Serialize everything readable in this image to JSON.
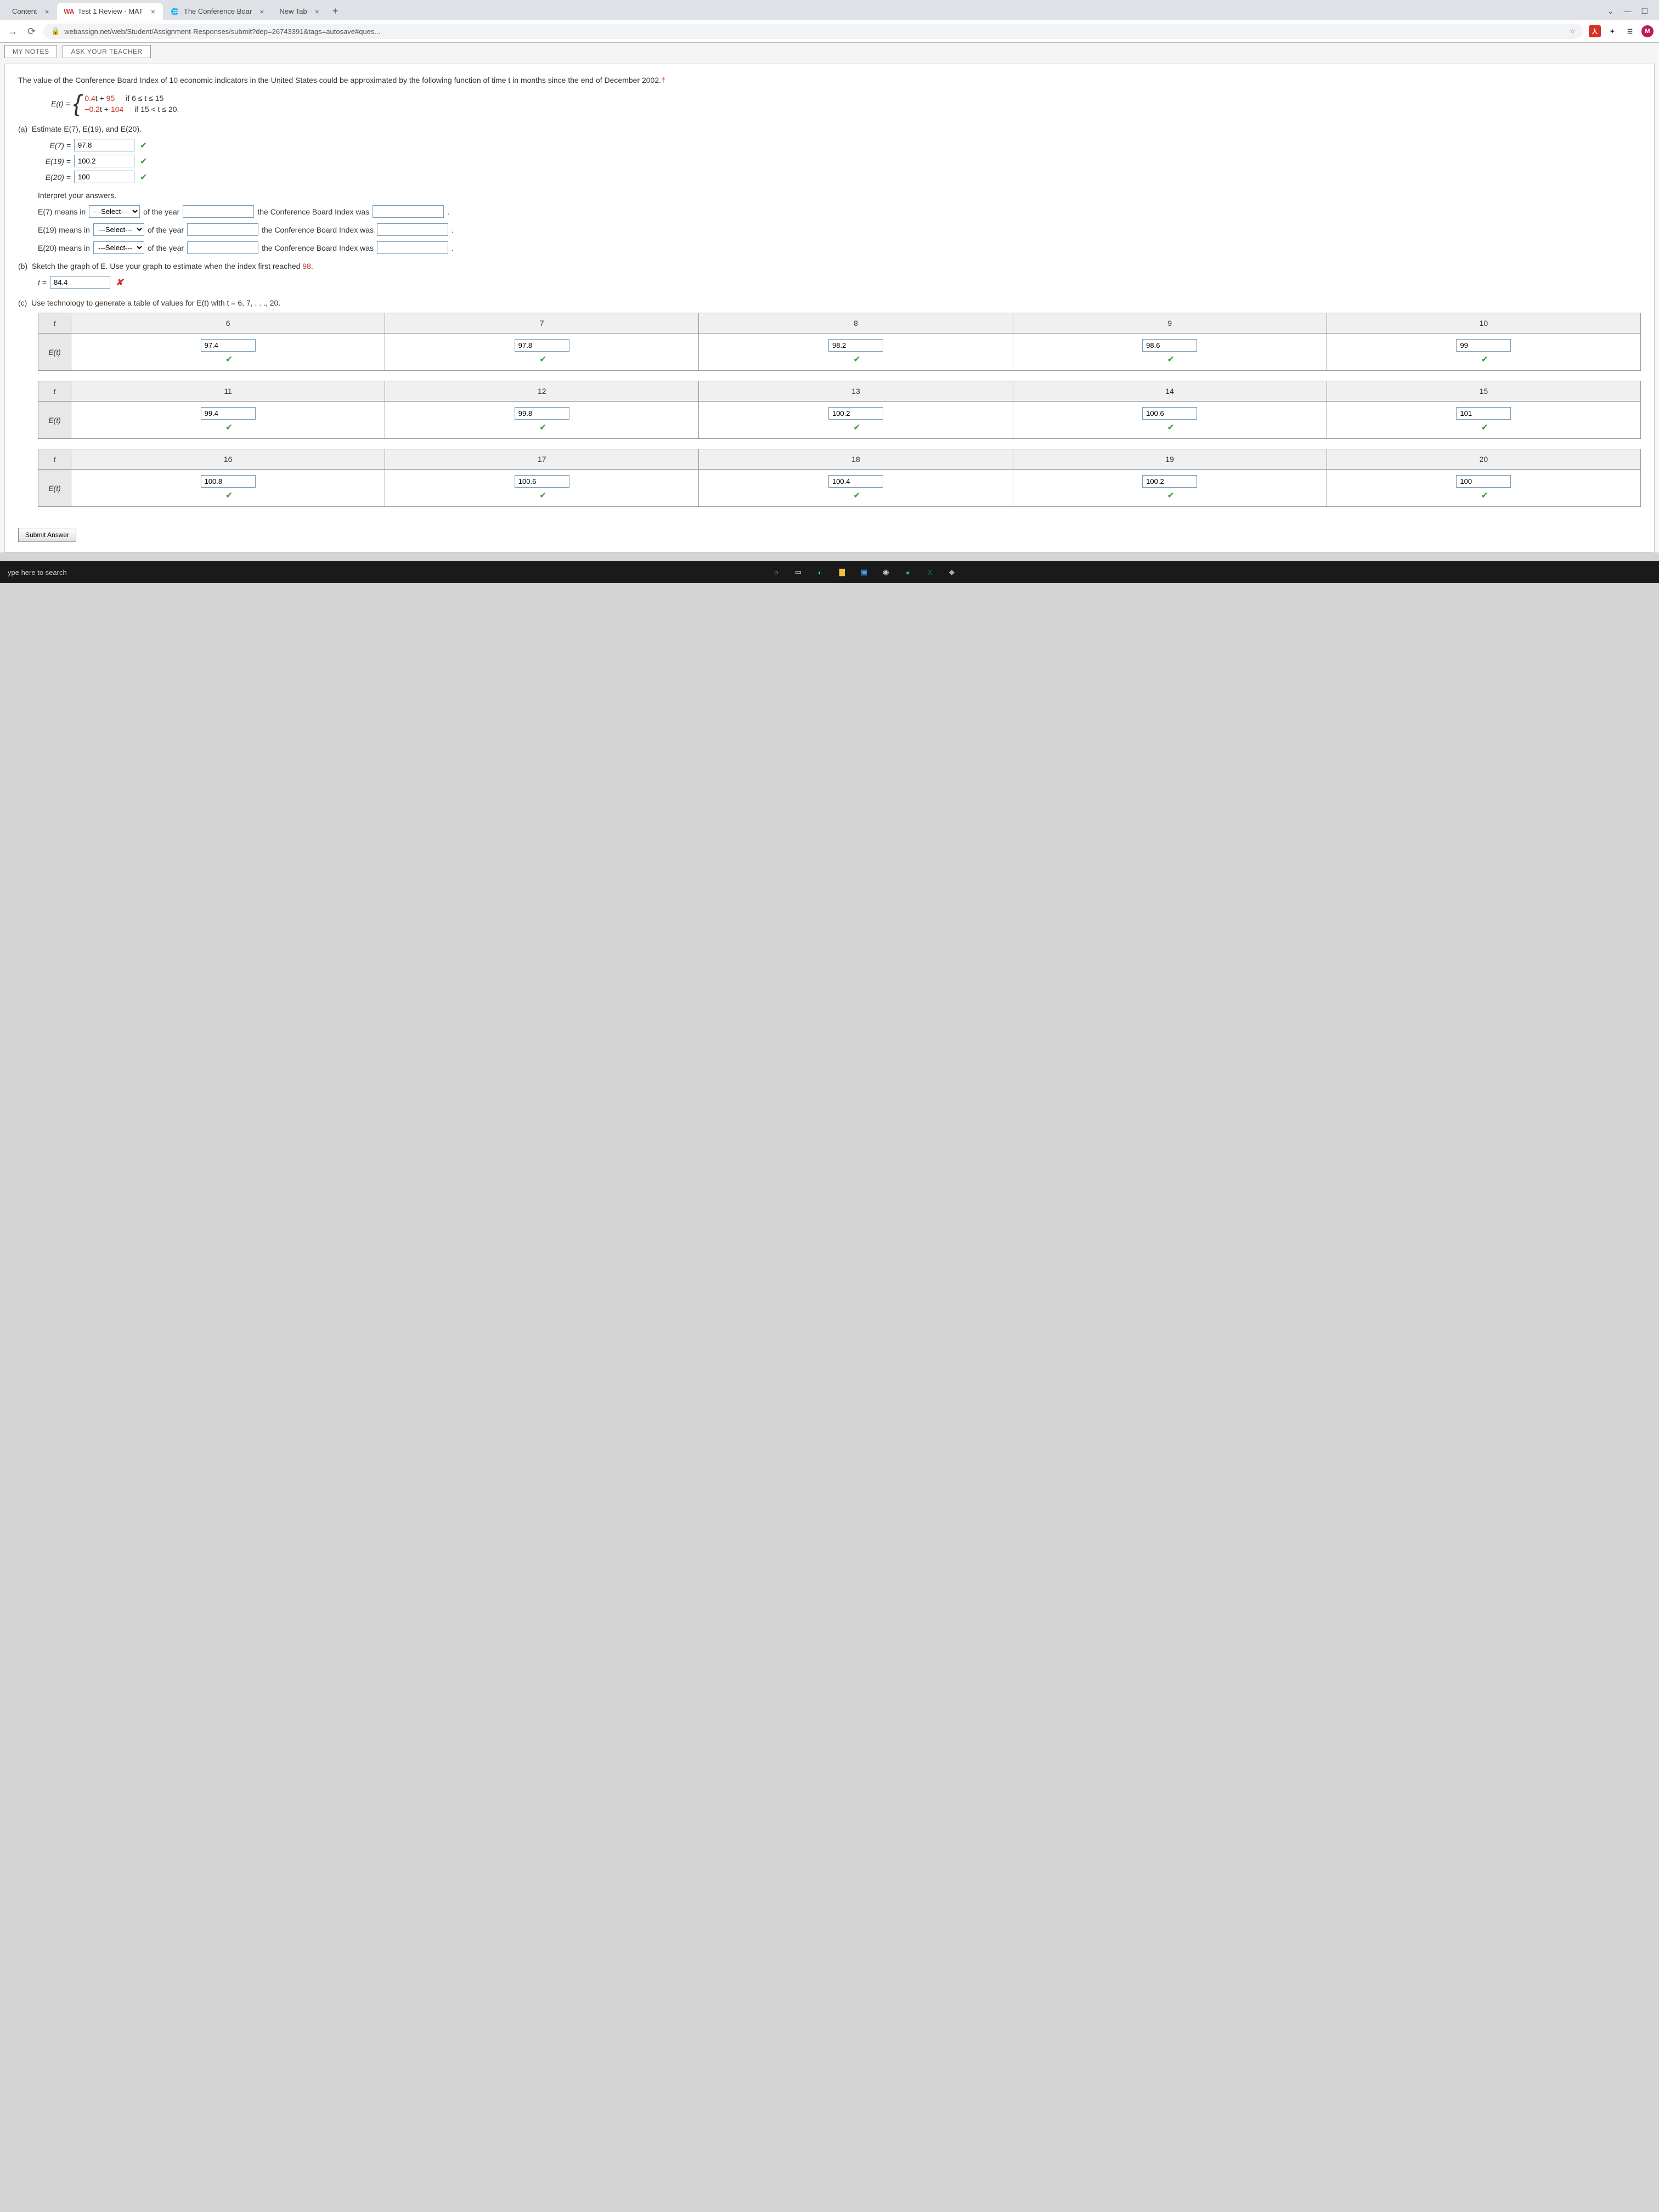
{
  "tabs": [
    {
      "title": "Content",
      "icon": ""
    },
    {
      "title": "Test 1 Review - MAT",
      "icon": "WA"
    },
    {
      "title": "The Conference Boar",
      "icon": "🌐"
    },
    {
      "title": "New Tab",
      "icon": ""
    }
  ],
  "url": "webassign.net/web/Student/Assignment-Responses/submit?dep=26743391&tags=autosave#ques...",
  "topButtons": {
    "notes": "MY NOTES",
    "ask": "ASK YOUR TEACHER"
  },
  "intro": "The value of the Conference Board Index of 10 economic indicators in the United States could be approximated by the following function of time t in months since the end of December 2002.",
  "dagger": "†",
  "piecewise": {
    "lhs": "E(t) =",
    "rows": [
      {
        "a": "0.4",
        "b": "t + ",
        "c": "95",
        "cond": "if 6 ≤ t ≤ 15"
      },
      {
        "a": "−0.2",
        "b": "t + ",
        "c": "104",
        "cond": "if 15 < t ≤ 20."
      }
    ]
  },
  "partA": {
    "label": "(a)",
    "prompt": "Estimate E(7), E(19), and E(20).",
    "rows": [
      {
        "lhs": "E(7) =",
        "val": "97.8"
      },
      {
        "lhs": "E(19) =",
        "val": "100.2"
      },
      {
        "lhs": "E(20) =",
        "val": "100"
      }
    ],
    "interpret": "Interpret your answers.",
    "irows": [
      {
        "pre": "E(7) means in",
        "mid": "of the year",
        "post": "the Conference Board Index was"
      },
      {
        "pre": "E(19) means in",
        "mid": "of the year",
        "post": "the Conference Board Index was"
      },
      {
        "pre": "E(20) means in",
        "mid": "of the year",
        "post": "the Conference Board Index was"
      }
    ],
    "selectPlaceholder": "---Select---"
  },
  "partB": {
    "label": "(b)",
    "prompt1": "Sketch the graph of E. Use your graph to estimate when the index first reached ",
    "prompt2": "98",
    "prompt3": ".",
    "tlhs": "t =",
    "tval": "84.4"
  },
  "partC": {
    "label": "(c)",
    "prompt": "Use technology to generate a table of values for E(t) with t = 6, 7, . . ., 20.",
    "tables": [
      {
        "t": [
          "6",
          "7",
          "8",
          "9",
          "10"
        ],
        "e": [
          "97.4",
          "97.8",
          "98.2",
          "98.6",
          "99"
        ]
      },
      {
        "t": [
          "11",
          "12",
          "13",
          "14",
          "15"
        ],
        "e": [
          "99.4",
          "99.8",
          "100.2",
          "100.6",
          "101"
        ]
      },
      {
        "t": [
          "16",
          "17",
          "18",
          "19",
          "20"
        ],
        "e": [
          "100.8",
          "100.6",
          "100.4",
          "100.2",
          "100"
        ]
      }
    ],
    "thead_t": "t",
    "thead_e": "E(t)"
  },
  "submit": "Submit Answer",
  "taskbar": {
    "search": "ype here to search"
  }
}
